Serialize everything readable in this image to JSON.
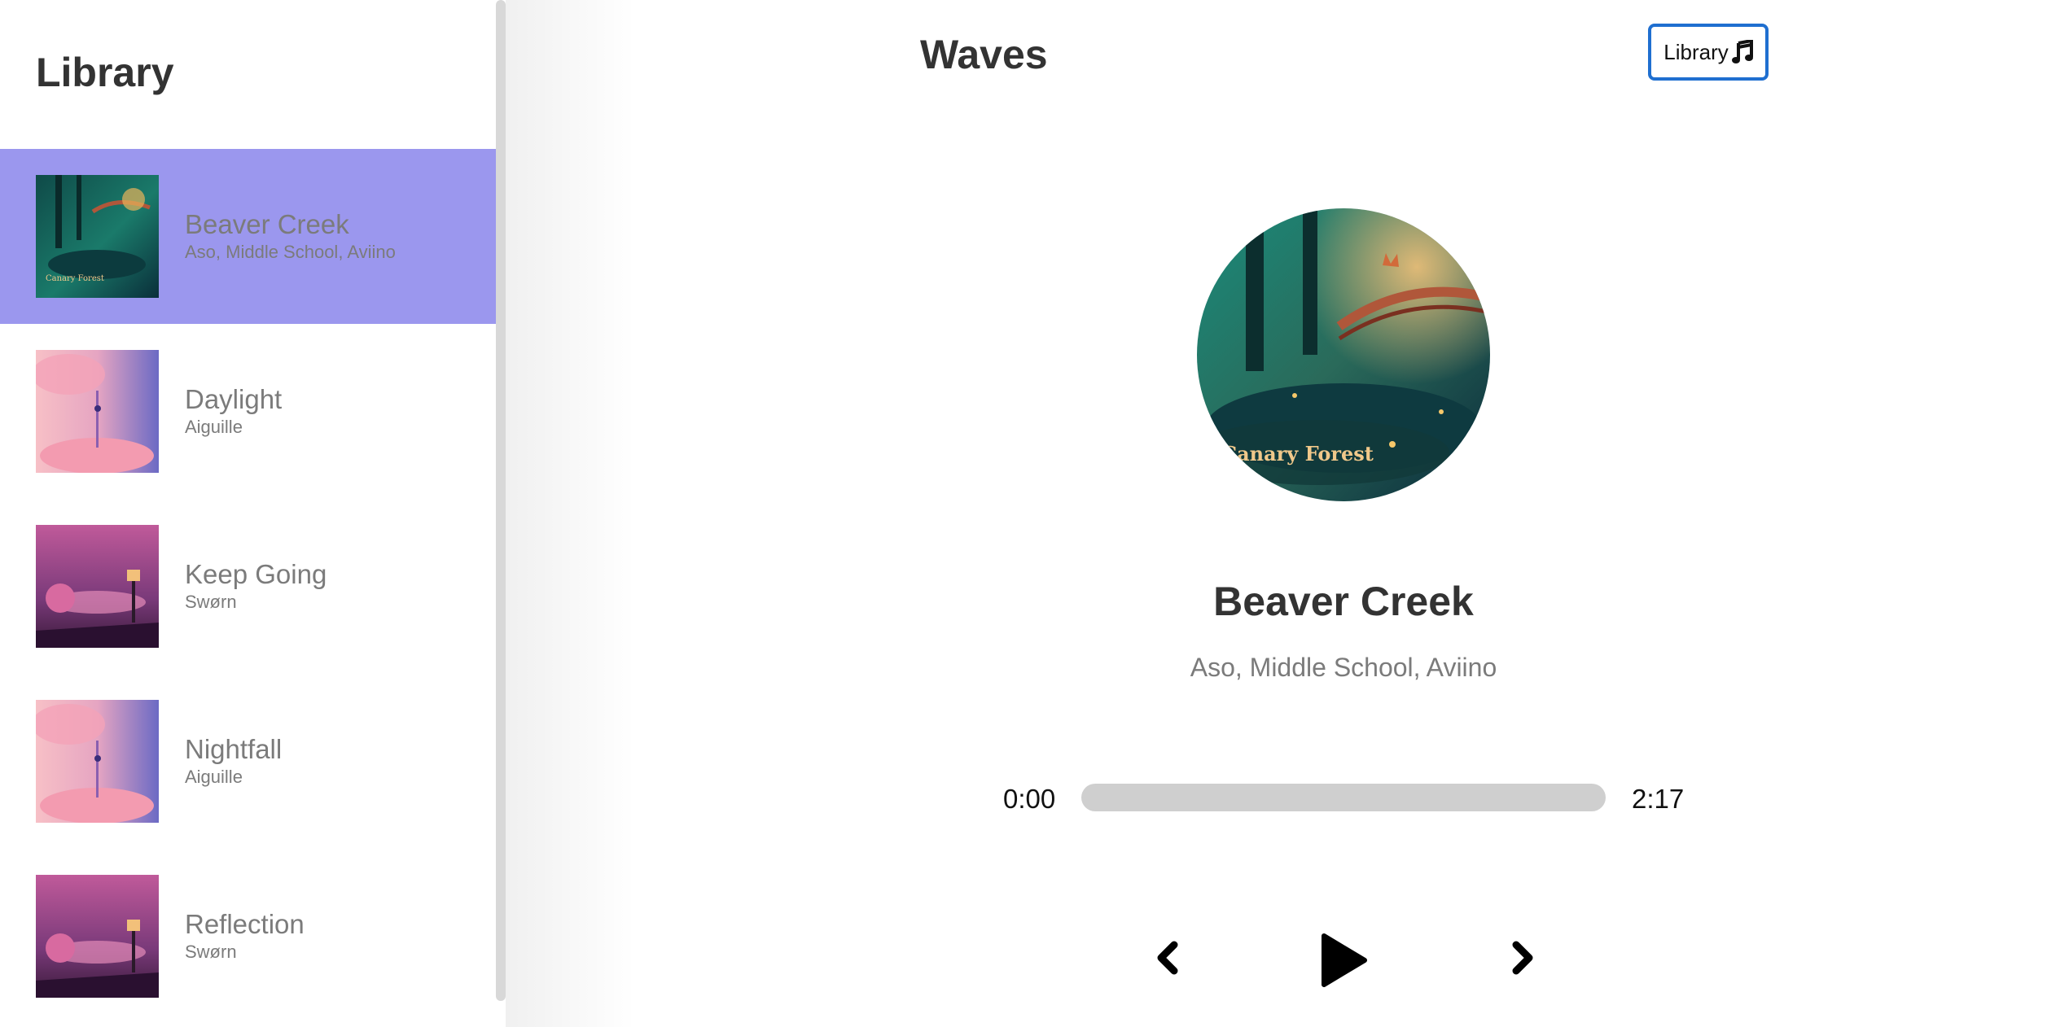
{
  "sidebar": {
    "title": "Library",
    "songs": [
      {
        "name": "Beaver Creek",
        "artist": "Aso, Middle School, Aviino",
        "active": true
      },
      {
        "name": "Daylight",
        "artist": "Aiguille",
        "active": false
      },
      {
        "name": "Keep Going",
        "artist": "Swørn",
        "active": false
      },
      {
        "name": "Nightfall",
        "artist": "Aiguille",
        "active": false
      },
      {
        "name": "Reflection",
        "artist": "Swørn",
        "active": false
      }
    ]
  },
  "header": {
    "title": "Waves",
    "library_button_label": "Library",
    "library_button_icon": "music-note-icon"
  },
  "player": {
    "title": "Beaver Creek",
    "artist": "Aso, Middle School, Aviino",
    "current_time": "0:00",
    "total_time": "2:17",
    "progress": 0,
    "controls": [
      "prev-chevron-icon",
      "play-icon",
      "next-chevron-icon"
    ]
  },
  "colors": {
    "accent": "#9b97ee",
    "button_border": "#1f6fd0",
    "track": "#cfcfcf"
  }
}
